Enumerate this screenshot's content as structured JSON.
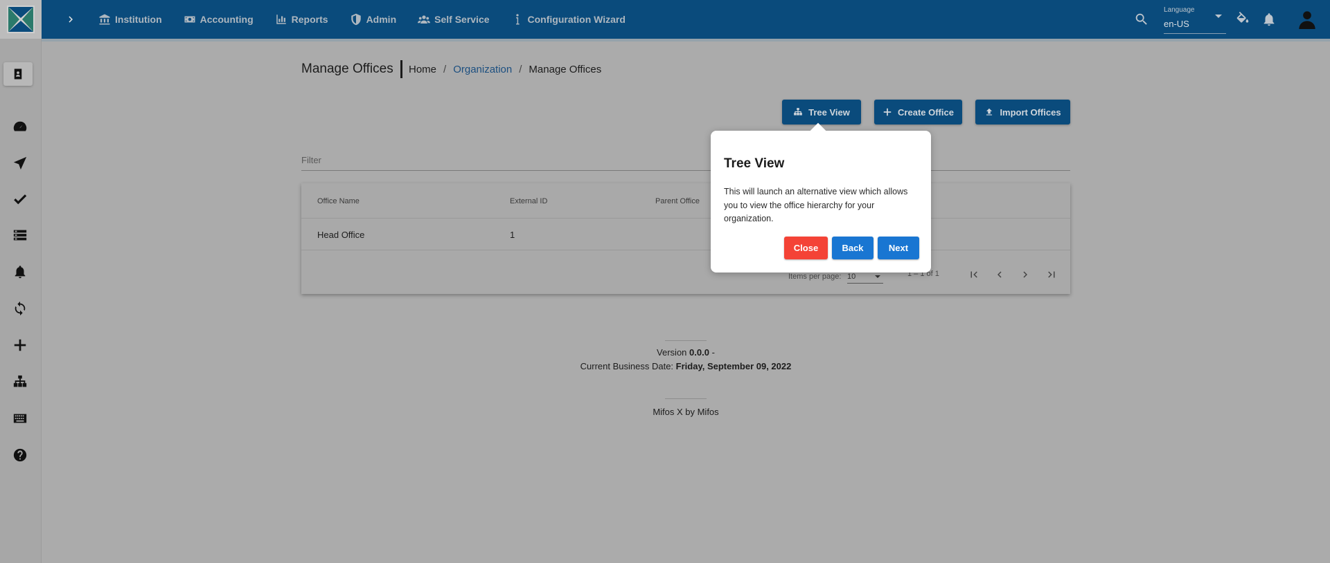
{
  "topbar": {
    "nav": [
      {
        "label": "Institution",
        "icon": "institution-icon"
      },
      {
        "label": "Accounting",
        "icon": "money-icon"
      },
      {
        "label": "Reports",
        "icon": "chart-icon"
      },
      {
        "label": "Admin",
        "icon": "shield-icon"
      },
      {
        "label": "Self Service",
        "icon": "users-icon"
      },
      {
        "label": "Configuration Wizard",
        "icon": "info-icon"
      }
    ],
    "language_label": "Language",
    "language_value": "en-US"
  },
  "page": {
    "title": "Manage Offices",
    "breadcrumb": {
      "home": "Home",
      "sep": "/",
      "organization": "Organization",
      "current": "Manage Offices"
    },
    "buttons": {
      "tree_view": "Tree View",
      "create_office": "Create Office",
      "import_offices": "Import Offices"
    },
    "filter_placeholder": "Filter"
  },
  "table": {
    "headers": {
      "office_name": "Office Name",
      "external_id": "External ID",
      "parent_office": "Parent Office"
    },
    "rows": [
      {
        "office_name": "Head Office",
        "external_id": "1",
        "parent_office": ""
      }
    ],
    "items_per_page_label": "Items per page:",
    "items_per_page_value": "10",
    "range": "1 – 1 of 1"
  },
  "footer": {
    "version_label": "Version",
    "version_value": "0.0.0",
    "version_suffix": "-",
    "business_date_label": "Current Business Date:",
    "business_date_value": "Friday, September 09, 2022",
    "credit": "Mifos X by Mifos"
  },
  "popover": {
    "title": "Tree View",
    "body": "This will launch an alternative view which allows you to view the office hierarchy for your organization.",
    "close": "Close",
    "back": "Back",
    "next": "Next"
  },
  "colors": {
    "primary": "#0a4b7c",
    "overlay_bg": "#ababab",
    "close_btn": "#f44336",
    "nav_btn": "#1976d2"
  }
}
